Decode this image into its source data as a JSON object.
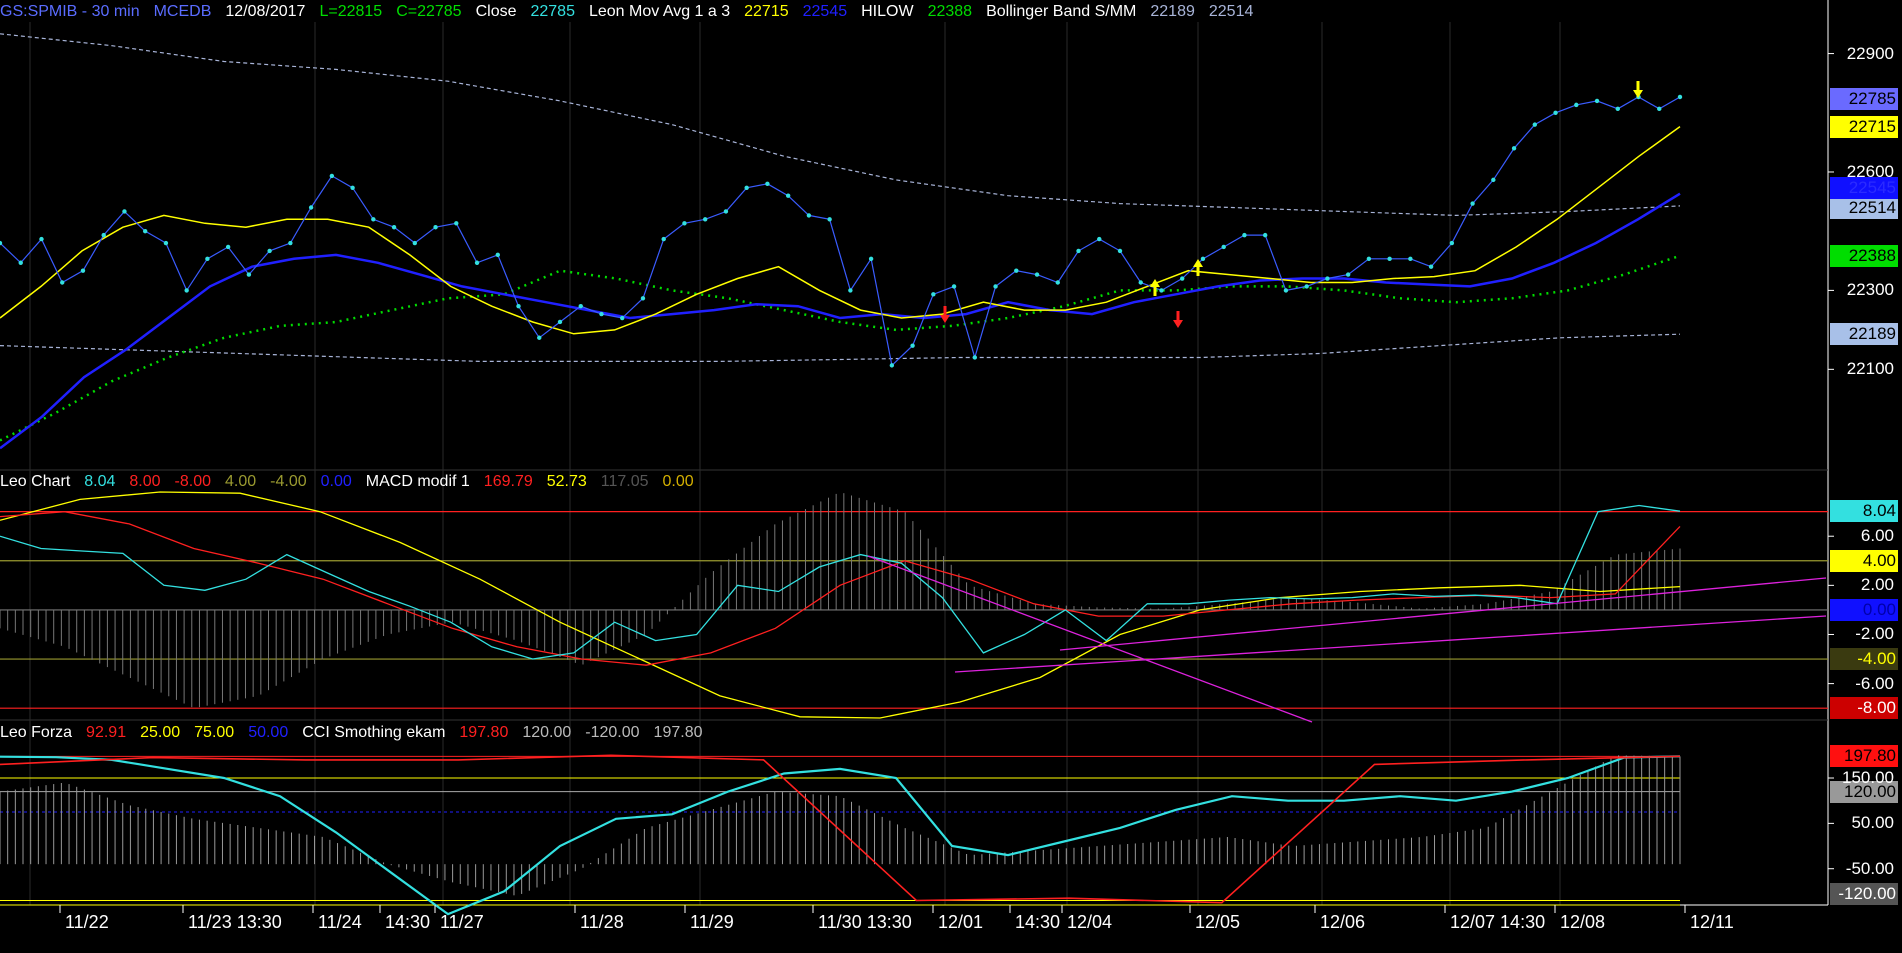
{
  "colors": {
    "cyan": "#33e0e0",
    "yellow": "#ffff00",
    "blue": "#2020ff",
    "green": "#00dd00",
    "red": "#ff2020",
    "white": "#ffffff",
    "olive": "#9a9a30",
    "gray": "#888888",
    "hilowblue": "#1010ff",
    "band": "#a8b4d8",
    "magenta": "#dd22dd"
  },
  "header_main": [
    {
      "text": "GS:SPMIB - 30 min",
      "color": "#5a6cff"
    },
    {
      "text": "MCEDB",
      "color": "#5a6cff"
    },
    {
      "text": "12/08/2017",
      "color": "#ffffff"
    },
    {
      "text": "L=22815",
      "color": "#00dd00"
    },
    {
      "text": "C=22785",
      "color": "#00dd00"
    },
    {
      "text": "Close",
      "color": "#ffffff"
    },
    {
      "text": "22785",
      "color": "#33e0e0"
    },
    {
      "text": "Leon Mov Avg 1 a 3",
      "color": "#ffffff"
    },
    {
      "text": "22715",
      "color": "#ffff00"
    },
    {
      "text": "22545",
      "color": "#2020ff"
    },
    {
      "text": "HILOW",
      "color": "#ffffff"
    },
    {
      "text": "22388",
      "color": "#00dd00"
    },
    {
      "text": "Bollinger Band S/MM",
      "color": "#ffffff"
    },
    {
      "text": "22189",
      "color": "#a8b4d8"
    },
    {
      "text": "22514",
      "color": "#a8b4d8"
    }
  ],
  "header_macd": [
    {
      "text": "Leo Chart",
      "color": "#ffffff"
    },
    {
      "text": "8.04",
      "color": "#33e0e0"
    },
    {
      "text": "8.00",
      "color": "#ff2020"
    },
    {
      "text": "-8.00",
      "color": "#ff2020"
    },
    {
      "text": "4.00",
      "color": "#9a9a30"
    },
    {
      "text": "-4.00",
      "color": "#9a9a30"
    },
    {
      "text": "0.00",
      "color": "#2020ff"
    },
    {
      "text": "MACD modif 1",
      "color": "#ffffff"
    },
    {
      "text": "169.79",
      "color": "#ff2020"
    },
    {
      "text": "52.73",
      "color": "#ffff00"
    },
    {
      "text": "117.05",
      "color": "#555555"
    },
    {
      "text": "0.00",
      "color": "#d4b000"
    }
  ],
  "header_cci": [
    {
      "text": "Leo Forza",
      "color": "#ffffff"
    },
    {
      "text": "92.91",
      "color": "#ff2020"
    },
    {
      "text": "25.00",
      "color": "#ffff00"
    },
    {
      "text": "75.00",
      "color": "#ffff00"
    },
    {
      "text": "50.00",
      "color": "#2020ff"
    },
    {
      "text": "CCI Smothing ekam",
      "color": "#ffffff"
    },
    {
      "text": "197.80",
      "color": "#ff2020"
    },
    {
      "text": "120.00",
      "color": "#bbbbbb"
    },
    {
      "text": "-120.00",
      "color": "#bbbbbb"
    },
    {
      "text": "197.80",
      "color": "#bbbbbb"
    }
  ],
  "chart_data": [
    {
      "type": "line",
      "title": "GS:SPMIB - 30 min",
      "x_ticks": [
        "11/22",
        "11/23 13:30",
        "11/24",
        "14:30",
        "11/27",
        "11/28",
        "11/29",
        "11/30 13:30",
        "12/01",
        "14:30",
        "12/04",
        "12/05",
        "12/06",
        "12/07 14:30",
        "12/08",
        "12/11"
      ],
      "y_ticks": [
        "22900",
        "22600",
        "22300",
        "22100"
      ],
      "ylim": [
        21850,
        22980
      ],
      "series": [
        {
          "name": "Close",
          "color": "#33e0e0",
          "values": [
            22420,
            22370,
            22430,
            22320,
            22350,
            22440,
            22500,
            22450,
            22420,
            22300,
            22380,
            22410,
            22340,
            22400,
            22420,
            22510,
            22590,
            22560,
            22480,
            22460,
            22420,
            22460,
            22470,
            22370,
            22390,
            22260,
            22180,
            22220,
            22260,
            22240,
            22230,
            22280,
            22430,
            22470,
            22480,
            22500,
            22560,
            22570,
            22540,
            22490,
            22480,
            22300,
            22380,
            22110,
            22160,
            22290,
            22310,
            22130,
            22310,
            22350,
            22340,
            22320,
            22400,
            22430,
            22400,
            22320,
            22300,
            22330,
            22380,
            22410,
            22440,
            22440,
            22300,
            22310,
            22330,
            22340,
            22380,
            22380,
            22380,
            22360,
            22420,
            22520,
            22580,
            22660,
            22720,
            22750,
            22770,
            22780,
            22760,
            22790,
            22760,
            22790
          ]
        },
        {
          "name": "Leon Mov Avg 1 a 3",
          "color": "#ffff00",
          "values": [
            22230,
            22310,
            22400,
            22460,
            22490,
            22470,
            22460,
            22480,
            22480,
            22460,
            22390,
            22310,
            22260,
            22220,
            22190,
            22200,
            22240,
            22290,
            22330,
            22360,
            22300,
            22250,
            22230,
            22240,
            22270,
            22250,
            22250,
            22270,
            22310,
            22350,
            22340,
            22330,
            22320,
            22320,
            22330,
            22335,
            22350,
            22410,
            22480,
            22560,
            22640,
            22715
          ]
        },
        {
          "name": "Leon Mov Avg",
          "color": "#2020ff",
          "values": [
            21900,
            21980,
            22080,
            22150,
            22230,
            22310,
            22360,
            22380,
            22390,
            22370,
            22340,
            22310,
            22290,
            22270,
            22250,
            22230,
            22240,
            22250,
            22265,
            22260,
            22230,
            22240,
            22230,
            22240,
            22270,
            22250,
            22240,
            22270,
            22290,
            22310,
            22325,
            22330,
            22330,
            22320,
            22315,
            22310,
            22330,
            22370,
            22420,
            22480,
            22545
          ]
        },
        {
          "name": "HILOW",
          "color": "#00dd00",
          "values": [
            21920,
            21990,
            22070,
            22130,
            22180,
            22210,
            22220,
            22250,
            22280,
            22290,
            22350,
            22330,
            22300,
            22280,
            22250,
            22220,
            22200,
            22210,
            22230,
            22260,
            22300,
            22300,
            22310,
            22310,
            22300,
            22280,
            22270,
            22280,
            22300,
            22340,
            22388
          ]
        },
        {
          "name": "Bollinger Band upper",
          "color": "#a8b4d8",
          "values": [
            22950,
            22920,
            22880,
            22860,
            22830,
            22780,
            22720,
            22640,
            22580,
            22540,
            22520,
            22510,
            22500,
            22490,
            22500,
            22514
          ]
        },
        {
          "name": "Bollinger Band lower",
          "color": "#a8b4d8",
          "values": [
            22160,
            22150,
            22140,
            22130,
            22120,
            22120,
            22120,
            22125,
            22130,
            22130,
            22130,
            22140,
            22160,
            22180,
            22189
          ]
        }
      ],
      "last_values": {
        "close": "22785",
        "ma1": "22715",
        "ma2": "22545",
        "hilow": "22388",
        "bb_up": "22514",
        "bb_lo": "22189"
      }
    },
    {
      "type": "line",
      "title": "Leo Chart / MACD modif 1",
      "y_ticks": [
        "6.00",
        "2.00",
        "-2.00",
        "-6.00"
      ],
      "ylim": [
        -8.8,
        9.6
      ],
      "levels": [
        8,
        4,
        0,
        -4,
        -8
      ],
      "series": [
        {
          "name": "Leo Chart",
          "color": "#33e0e0",
          "values": [
            6.0,
            5.0,
            4.8,
            4.6,
            2.0,
            1.6,
            2.5,
            4.5,
            3.0,
            1.5,
            0.3,
            -1.0,
            -3.0,
            -4.0,
            -3.5,
            -1.0,
            -2.5,
            -2.0,
            2.0,
            1.5,
            3.5,
            4.5,
            3.8,
            1.0,
            -3.5,
            -2.0,
            0.0,
            -2.5,
            0.5,
            0.5,
            0.8,
            1.0,
            0.9,
            1.0,
            1.3,
            1.1,
            1.2,
            1.0,
            0.5,
            8.0,
            8.5,
            8.04
          ]
        },
        {
          "name": "MACD",
          "color": "#ff2020",
          "values": [
            7.6,
            8.0,
            7.0,
            5.0,
            3.8,
            2.5,
            0.5,
            -1.5,
            -3.0,
            -4.0,
            -4.5,
            -3.5,
            -1.5,
            2.0,
            4.0,
            2.5,
            0.5,
            -0.5,
            -0.5,
            0.0,
            0.5,
            0.8,
            1.0,
            1.2,
            1.0,
            1.3,
            6.8
          ]
        },
        {
          "name": "Signal",
          "color": "#ffff00",
          "values": [
            7.3,
            9.0,
            9.6,
            9.5,
            8.0,
            5.5,
            2.5,
            -1.0,
            -4.0,
            -7.0,
            -8.7,
            -8.8,
            -7.5,
            -5.5,
            -2.0,
            0.0,
            1.0,
            1.5,
            1.8,
            2.0,
            1.5,
            1.9
          ]
        },
        {
          "name": "Histogram",
          "color": "#888888",
          "values": [
            -1.5,
            -3.0,
            -5.5,
            -8.0,
            -7.0,
            -4.0,
            -2.0,
            -1.0,
            -2.5,
            -4.5,
            -2.0,
            3.0,
            7.0,
            9.6,
            8.0,
            2.0,
            0.5,
            0.2,
            0.1,
            0.5,
            1.0,
            0.6,
            0.1,
            0.5,
            1.5,
            4.5,
            5.0
          ]
        }
      ],
      "markers": [
        "8.04",
        "4.00",
        "0.00",
        "-4.00",
        "-8.00"
      ]
    },
    {
      "type": "line",
      "title": "Leo Forza / CCI Smothing ekam",
      "y_ticks": [
        "150.00",
        "50.00",
        "-50.00"
      ],
      "ylim": [
        -130,
        225
      ],
      "levels": [
        197.8,
        120,
        -120
      ],
      "series": [
        {
          "name": "CCI Smothing ekam",
          "color": "#33e0e0",
          "values": [
            197,
            196,
            190,
            170,
            150,
            110,
            30,
            -60,
            -150,
            -100,
            0,
            60,
            70,
            120,
            160,
            170,
            150,
            0,
            -20,
            10,
            40,
            80,
            110,
            100,
            100,
            110,
            100,
            120,
            150,
            195,
            197.8
          ]
        },
        {
          "name": "Leo Forza",
          "color": "#ff2020",
          "values": [
            180,
            195,
            190,
            190,
            200,
            190,
            -120,
            -115,
            -125,
            180,
            190,
            197.8
          ]
        },
        {
          "name": "CCI histogram",
          "color": "#aaaaaa",
          "values": [
            120,
            140,
            90,
            60,
            40,
            20,
            -40,
            -80,
            -110,
            -50,
            40,
            80,
            120,
            110,
            40,
            -20,
            -10,
            0,
            10,
            20,
            0,
            10,
            20,
            40,
            120,
            200,
            197.8
          ]
        }
      ],
      "markers": [
        "197.80",
        "120.00",
        "-120.00"
      ]
    }
  ]
}
